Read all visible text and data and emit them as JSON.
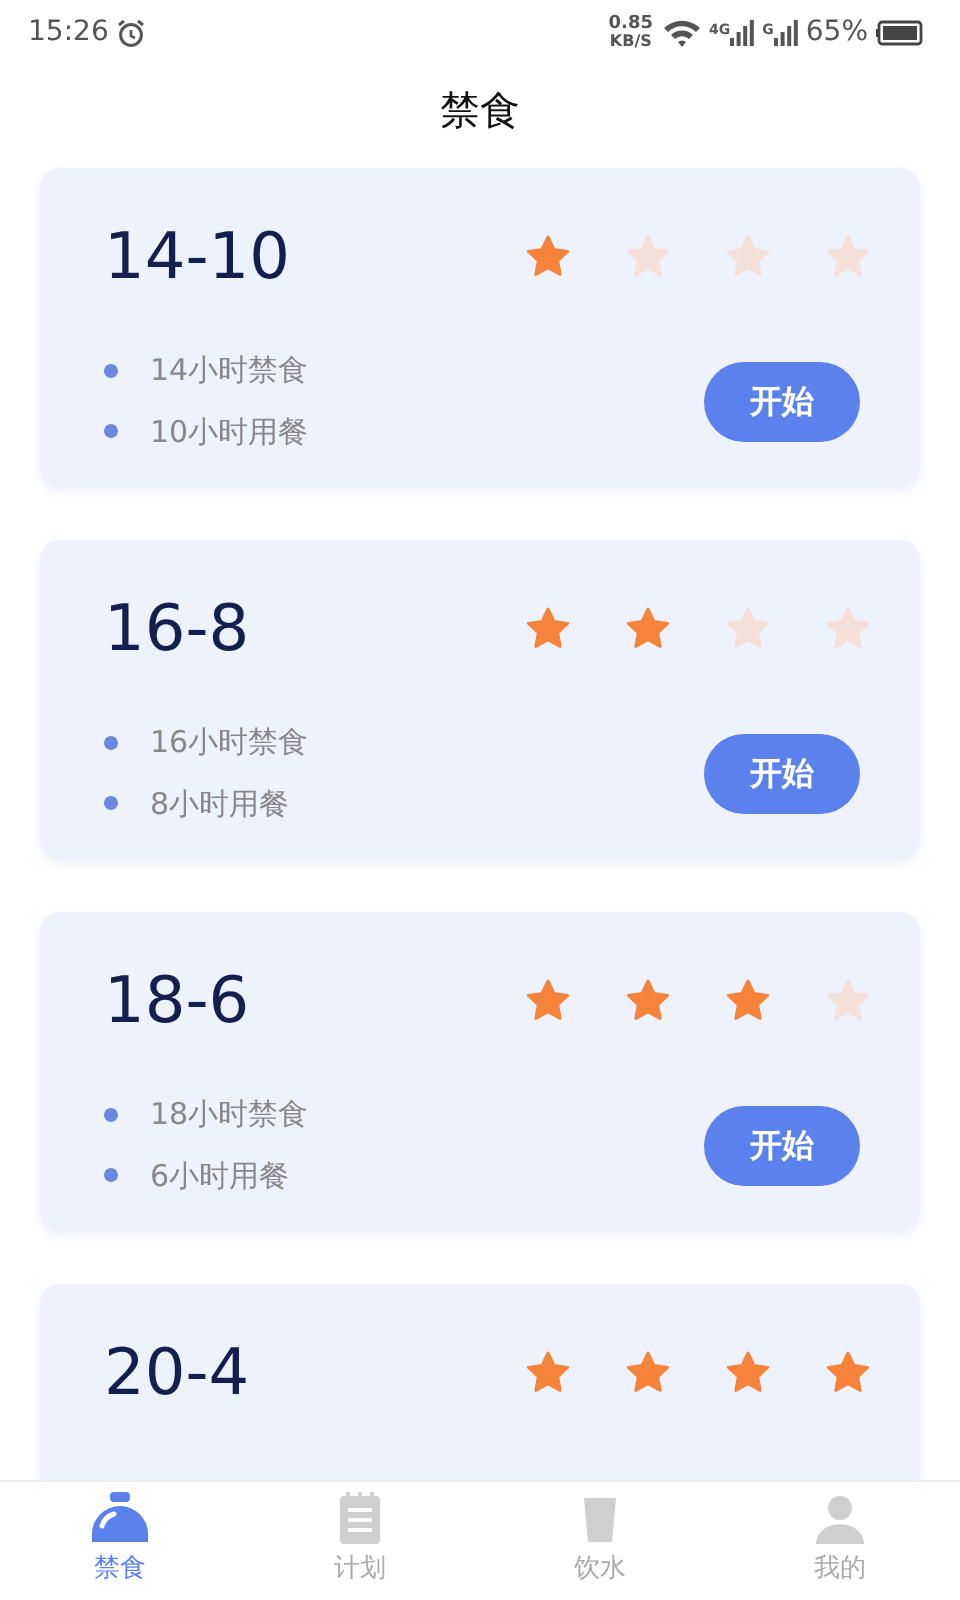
{
  "status_bar": {
    "time": "15:26",
    "speed_value": "0.85",
    "speed_unit": "KB/S",
    "signal_1_label": "4G",
    "signal_2_label": "G",
    "battery": "65%"
  },
  "header": {
    "title": "禁食"
  },
  "plans": [
    {
      "title": "14-10",
      "stars": 1,
      "items": [
        "14小时禁食",
        "10小时用餐"
      ],
      "button": "开始"
    },
    {
      "title": "16-8",
      "stars": 2,
      "items": [
        "16小时禁食",
        "8小时用餐"
      ],
      "button": "开始"
    },
    {
      "title": "18-6",
      "stars": 3,
      "items": [
        "18小时禁食",
        "6小时用餐"
      ],
      "button": "开始"
    },
    {
      "title": "20-4",
      "stars": 4
    }
  ],
  "tab_bar": [
    {
      "label": "禁食",
      "kind": "fasting",
      "selected": true
    },
    {
      "label": "计划",
      "kind": "plan",
      "selected": false
    },
    {
      "label": "饮水",
      "kind": "water",
      "selected": false
    },
    {
      "label": "我的",
      "kind": "profile",
      "selected": false
    }
  ]
}
